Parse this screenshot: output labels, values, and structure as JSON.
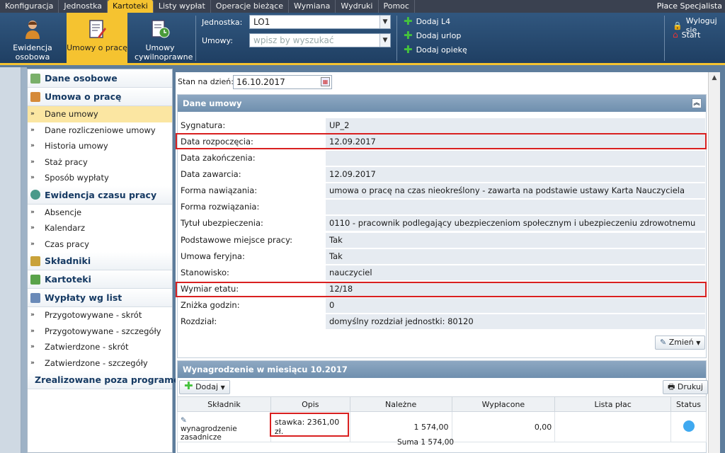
{
  "menu": {
    "items": [
      "Konfiguracja",
      "Jednostka",
      "Kartoteki",
      "Listy wypłat",
      "Operacje bieżące",
      "Wymiana",
      "Wydruki",
      "Pomoc"
    ],
    "app_title": "Płace Specjalista"
  },
  "ribbon": {
    "btn1": "Ewidencja osobowa",
    "btn2": "Umowy o pracę",
    "btn3": "Umowy cywilnoprawne",
    "jednostka_label": "Jednostka:",
    "jednostka_value": "LO1",
    "umowy_label": "Umowy:",
    "umowy_placeholder": "wpisz by wyszukać",
    "add_l4": "Dodaj L4",
    "add_urlop": "Dodaj urlop",
    "add_opieke": "Dodaj opiekę",
    "logout": "Wyloguj się",
    "start": "Start"
  },
  "sidebar": {
    "s1": "Dane osobowe",
    "s2": "Umowa o pracę",
    "i1": "Dane umowy",
    "i2": "Dane rozliczeniowe umowy",
    "i3": "Historia umowy",
    "i4": "Staż pracy",
    "i5": "Sposób wypłaty",
    "s3": "Ewidencja czasu pracy",
    "i6": "Absencje",
    "i7": "Kalendarz",
    "i8": "Czas pracy",
    "s4": "Składniki",
    "s5": "Kartoteki",
    "s6": "Wypłaty wg list",
    "i9": "Przygotowywane - skrót",
    "i10": "Przygotowywane - szczegóły",
    "i11": "Zatwierdzone - skrót",
    "i12": "Zatwierdzone - szczegóły",
    "s7": "Zrealizowane poza programem"
  },
  "stan": {
    "label": "Stan na dzień:",
    "value": "16.10.2017"
  },
  "dane": {
    "title": "Dane umowy",
    "fields": [
      {
        "label": "Sygnatura:",
        "value": "UP_2"
      },
      {
        "label": "Data rozpoczęcia:",
        "value": "12.09.2017"
      },
      {
        "label": "Data zakończenia:",
        "value": ""
      },
      {
        "label": "Data zawarcia:",
        "value": "12.09.2017"
      },
      {
        "label": "Forma nawiązania:",
        "value": "umowa o pracę na czas nieokreślony - zawarta na podstawie ustawy Karta Nauczyciela"
      },
      {
        "label": "Forma rozwiązania:",
        "value": ""
      },
      {
        "label": "Tytuł ubezpieczenia:",
        "value": "0110 - pracownik podlegający ubezpieczeniom społecznym i ubezpieczeniu zdrowotnemu"
      },
      {
        "label": "Podstawowe miejsce pracy:",
        "value": "Tak"
      },
      {
        "label": "Umowa feryjna:",
        "value": "Tak"
      },
      {
        "label": "Stanowisko:",
        "value": "nauczyciel"
      },
      {
        "label": "Wymiar etatu:",
        "value": "12/18"
      },
      {
        "label": "Zniżka godzin:",
        "value": "0"
      },
      {
        "label": "Rozdział:",
        "value": "domyślny rozdział jednostki: 80120"
      }
    ],
    "zmien": "Zmień"
  },
  "wyn": {
    "title": "Wynagrodzenie w miesiącu 10.2017",
    "dodaj": "Dodaj",
    "drukuj": "Drukuj",
    "cols": [
      "Składnik",
      "Opis",
      "Należne",
      "Wypłacone",
      "Lista płac",
      "Status"
    ],
    "row": {
      "skladnik": "wynagrodzenie zasadnicze",
      "opis": "stawka: 2361,00 zł.",
      "nalezne": "1 574,00",
      "wyplacone": "0,00",
      "lista": ""
    },
    "suma": "Suma 1 574,00"
  }
}
